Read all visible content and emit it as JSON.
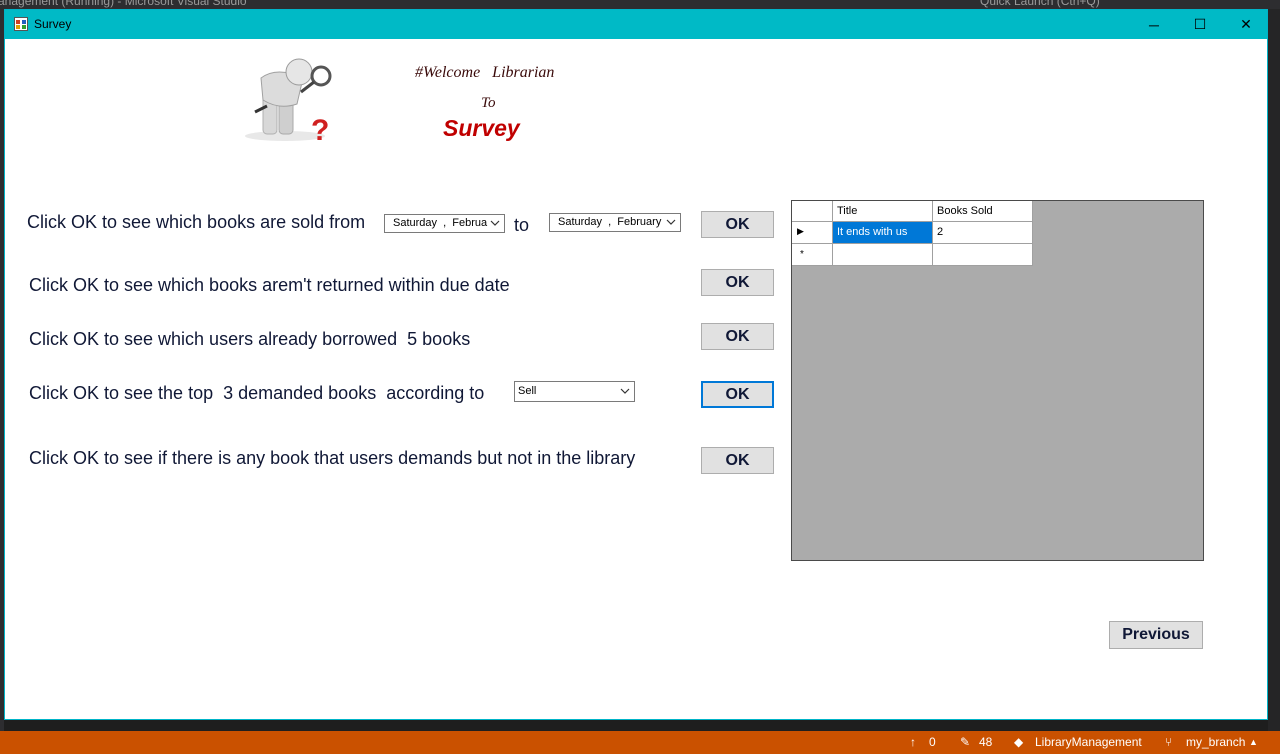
{
  "vs": {
    "title": "anagement (Running) - Microsoft Visual Studio",
    "quick_launch": "Quick Launch (Ctrl+Q)"
  },
  "window": {
    "title": "Survey",
    "minimize": "─",
    "maximize": "☐",
    "close": "✕"
  },
  "header": {
    "welcome": "#Welcome   Librarian",
    "to": "To",
    "survey": "Survey"
  },
  "questions": {
    "q1_label": "Click OK to see which books are sold from",
    "q1_to": "to",
    "q1_from_date": "Saturday  ,  Februa",
    "q1_to_date": "Saturday  ,  February",
    "q2_label": "Click OK to see which books arem't returned within due date",
    "q3_label": "Click OK to see which users already borrowed  5 books",
    "q4_label": "Click OK to see the top  3 demanded books  according to",
    "q4_option": "Sell",
    "q5_label": "Click OK to see if there is any book that users demands but not in the library",
    "ok_label": "OK"
  },
  "grid": {
    "columns": [
      "Title",
      "Books Sold"
    ],
    "rows": [
      [
        "It ends with us",
        "2"
      ]
    ],
    "new_row_marker": "*",
    "current_row_marker": "▶"
  },
  "footer": {
    "previous": "Previous"
  },
  "status_bar": {
    "push_count": "0",
    "changes_count": "48",
    "repo": "LibraryManagement",
    "branch": "my_branch"
  },
  "colors": {
    "titlebar": "#00bac6",
    "status_bar": "#ca5100",
    "survey_title": "#c00000",
    "selection": "#0078d7"
  }
}
